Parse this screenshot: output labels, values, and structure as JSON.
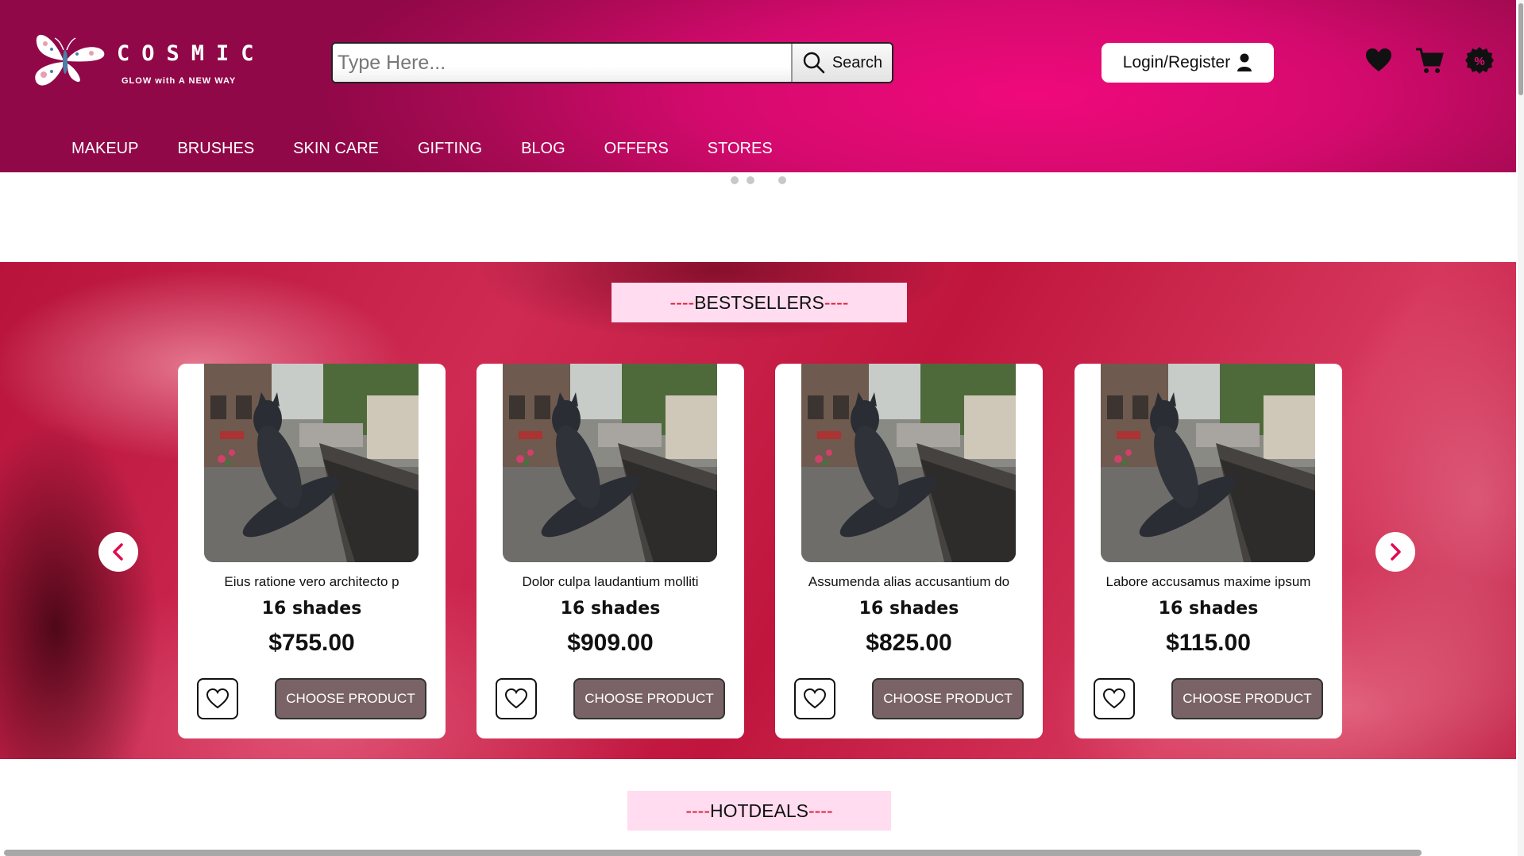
{
  "brand": {
    "name": "COSMIC",
    "tagline": "GLOW with A NEW WAY"
  },
  "search": {
    "placeholder": "Type Here...",
    "button_label": "Search"
  },
  "header": {
    "login_label": "Login/Register",
    "icons": [
      "heart-icon",
      "cart-icon",
      "discount-badge-icon"
    ]
  },
  "nav": {
    "items": [
      "MAKEUP",
      "BRUSHES",
      "SKIN CARE",
      "GIFTING",
      "BLOG",
      "OFFERS",
      "STORES"
    ]
  },
  "carousel_dots": {
    "count": 3
  },
  "bestsellers": {
    "title_dashes_left": "----",
    "title": "BESTSELLERS",
    "title_dashes_right": "----",
    "products": [
      {
        "name": "Eius ratione vero architecto p",
        "shades": "16 shades",
        "price": "$755.00",
        "button": "CHOOSE PRODUCT"
      },
      {
        "name": "Dolor culpa laudantium molliti",
        "shades": "16 shades",
        "price": "$909.00",
        "button": "CHOOSE PRODUCT"
      },
      {
        "name": "Assumenda alias accusantium do",
        "shades": "16 shades",
        "price": "$825.00",
        "button": "CHOOSE PRODUCT"
      },
      {
        "name": "Labore accusamus maxime ipsum",
        "shades": "16 shades",
        "price": "$115.00",
        "button": "CHOOSE PRODUCT"
      }
    ]
  },
  "hotdeals": {
    "title_dashes_left": "----",
    "title": "HOTDEALS",
    "title_dashes_right": "----"
  },
  "colors": {
    "accent": "#e20a76",
    "header_dark": "#900848",
    "button": "#7a6366",
    "section_title_bg": "#ffdcef"
  }
}
